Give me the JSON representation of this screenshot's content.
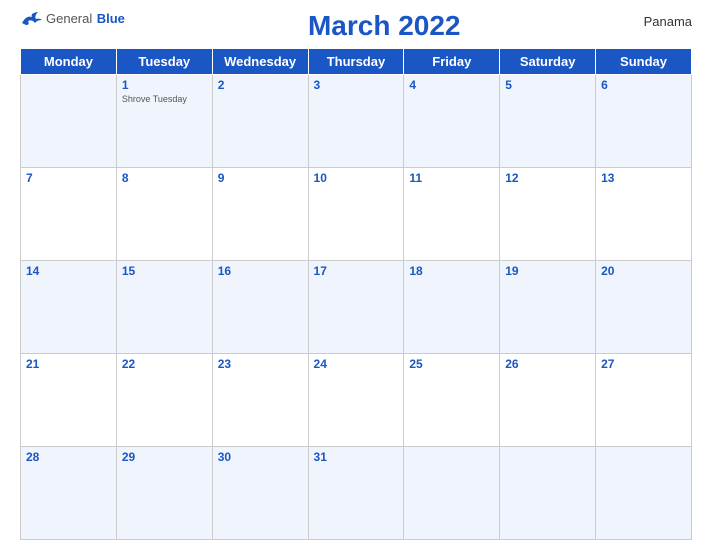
{
  "header": {
    "logo": {
      "general": "General",
      "blue": "Blue"
    },
    "title": "March 2022",
    "country": "Panama"
  },
  "days_of_week": [
    "Monday",
    "Tuesday",
    "Wednesday",
    "Thursday",
    "Friday",
    "Saturday",
    "Sunday"
  ],
  "weeks": [
    [
      {
        "num": "",
        "holiday": ""
      },
      {
        "num": "1",
        "holiday": "Shrove Tuesday"
      },
      {
        "num": "2",
        "holiday": ""
      },
      {
        "num": "3",
        "holiday": ""
      },
      {
        "num": "4",
        "holiday": ""
      },
      {
        "num": "5",
        "holiday": ""
      },
      {
        "num": "6",
        "holiday": ""
      }
    ],
    [
      {
        "num": "7",
        "holiday": ""
      },
      {
        "num": "8",
        "holiday": ""
      },
      {
        "num": "9",
        "holiday": ""
      },
      {
        "num": "10",
        "holiday": ""
      },
      {
        "num": "11",
        "holiday": ""
      },
      {
        "num": "12",
        "holiday": ""
      },
      {
        "num": "13",
        "holiday": ""
      }
    ],
    [
      {
        "num": "14",
        "holiday": ""
      },
      {
        "num": "15",
        "holiday": ""
      },
      {
        "num": "16",
        "holiday": ""
      },
      {
        "num": "17",
        "holiday": ""
      },
      {
        "num": "18",
        "holiday": ""
      },
      {
        "num": "19",
        "holiday": ""
      },
      {
        "num": "20",
        "holiday": ""
      }
    ],
    [
      {
        "num": "21",
        "holiday": ""
      },
      {
        "num": "22",
        "holiday": ""
      },
      {
        "num": "23",
        "holiday": ""
      },
      {
        "num": "24",
        "holiday": ""
      },
      {
        "num": "25",
        "holiday": ""
      },
      {
        "num": "26",
        "holiday": ""
      },
      {
        "num": "27",
        "holiday": ""
      }
    ],
    [
      {
        "num": "28",
        "holiday": ""
      },
      {
        "num": "29",
        "holiday": ""
      },
      {
        "num": "30",
        "holiday": ""
      },
      {
        "num": "31",
        "holiday": ""
      },
      {
        "num": "",
        "holiday": ""
      },
      {
        "num": "",
        "holiday": ""
      },
      {
        "num": "",
        "holiday": ""
      }
    ]
  ]
}
